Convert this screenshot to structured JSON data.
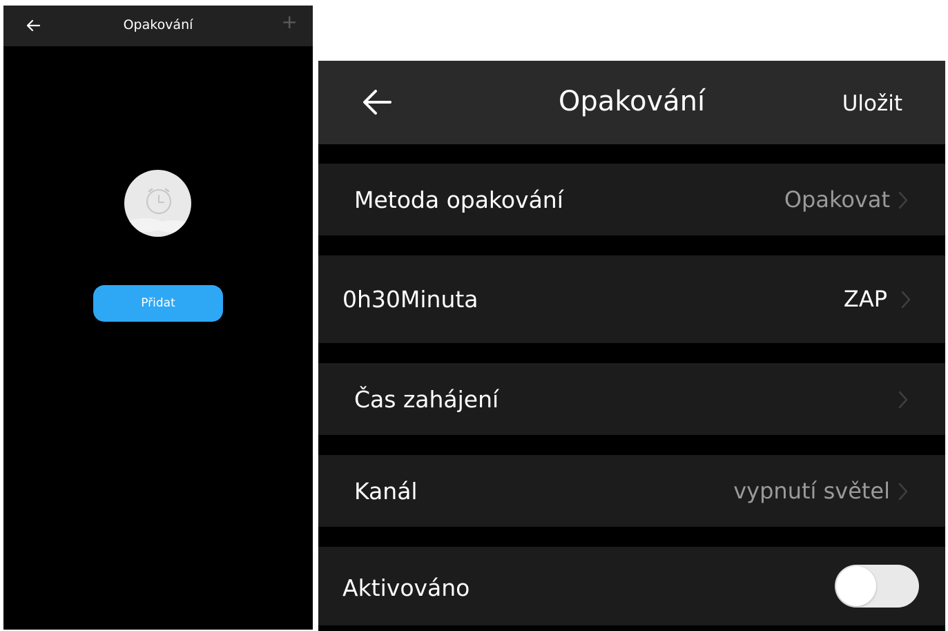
{
  "left": {
    "title": "Opakování",
    "plus_label": "+",
    "add_button_label": "Přidat",
    "icons": {
      "back": "arrow-left-icon",
      "empty": "alarm-clock-icon"
    }
  },
  "right": {
    "title": "Opakování",
    "save_label": "Uložit",
    "rows": [
      {
        "label": "Metoda opakování",
        "value": "Opakovat"
      },
      {
        "label": "0h30Minuta",
        "value": "ZAP"
      },
      {
        "label": "Čas zahájení",
        "value": ""
      },
      {
        "label": "Kanál",
        "value": "vypnutí světel"
      },
      {
        "label": "Aktivováno",
        "toggle_on": false
      }
    ],
    "icons": {
      "back": "arrow-left-icon",
      "chevron": "chevron-right-icon"
    }
  },
  "colors": {
    "accent": "#2ea8f5",
    "background": "#000000",
    "header": "#2a2a2a",
    "row": "#1c1c1c",
    "secondary_text": "#9a9a9a"
  }
}
